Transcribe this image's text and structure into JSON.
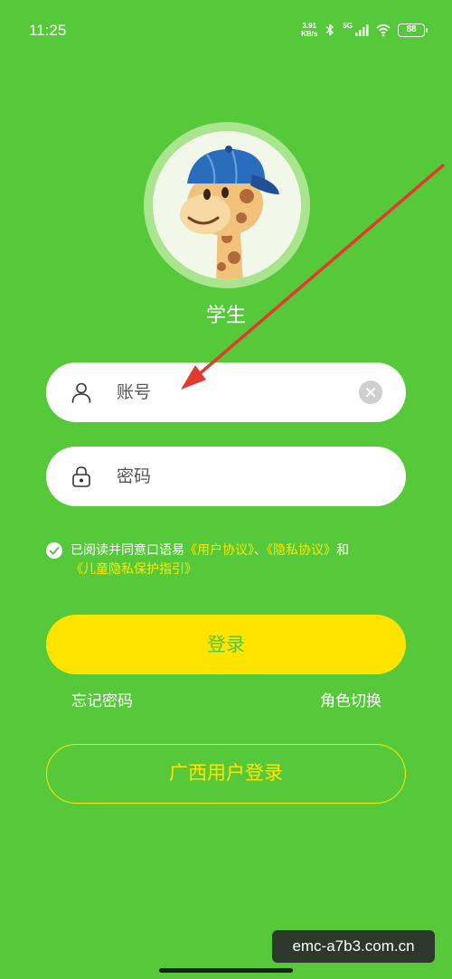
{
  "status_bar": {
    "time": "11:25",
    "net_speed_value": "3.91",
    "net_speed_unit": "KB/s",
    "signal_label": "5G",
    "battery": "88"
  },
  "profile": {
    "avatar_icon": "giraffe-cap-avatar",
    "role_title": "学生"
  },
  "form": {
    "account_placeholder": "账号",
    "password_placeholder": "密码"
  },
  "agreement": {
    "prefix": "已阅读并同意口语易",
    "user_agreement": "《用户协议》",
    "separator": "、",
    "privacy_agreement": "《隐私协议》",
    "conjunction": "和",
    "child_privacy": "《儿童隐私保护指引》"
  },
  "actions": {
    "login_label": "登录",
    "forgot_password": "忘记密码",
    "switch_role": "角色切换",
    "guangxi_login": "广西用户登录"
  },
  "watermark": "emc-a7b3.com.cn",
  "colors": {
    "background": "#56c93a",
    "accent_yellow": "#ffe400",
    "annotation_arrow": "#e03b2e"
  }
}
